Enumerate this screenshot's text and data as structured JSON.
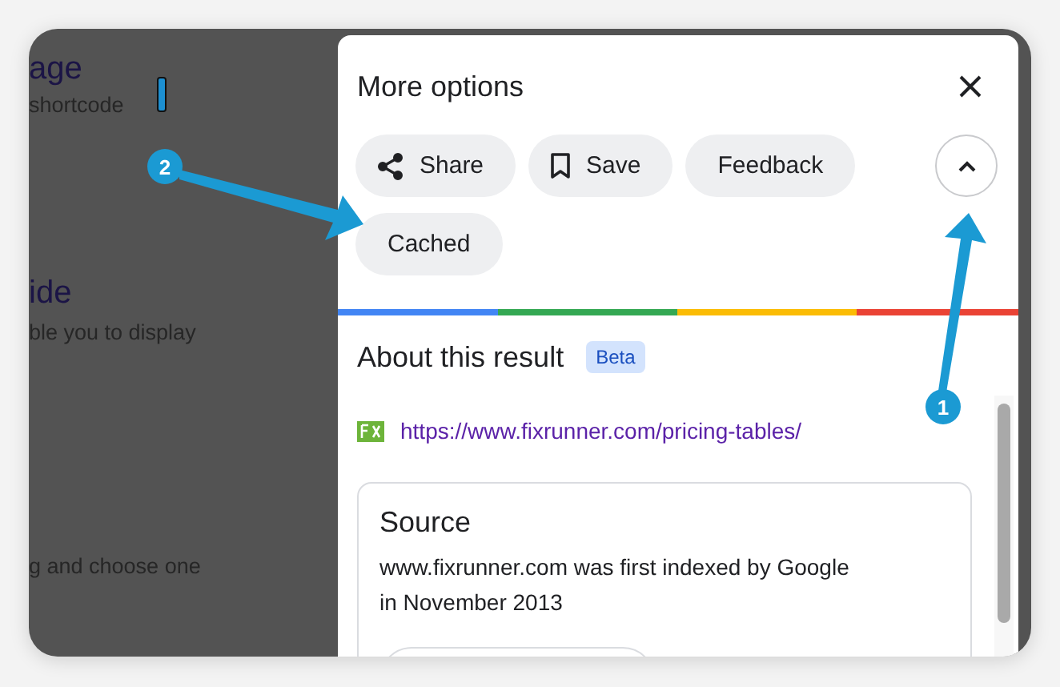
{
  "background_page": {
    "texts": [
      {
        "kind": "heading",
        "text": "age"
      },
      {
        "kind": "body",
        "text": "shortcode"
      },
      {
        "kind": "heading",
        "text": "ide"
      },
      {
        "kind": "body",
        "text": "ble you to display"
      },
      {
        "kind": "body",
        "text": "g and choose one"
      }
    ]
  },
  "panel": {
    "title": "More options",
    "expanded": true,
    "actions": [
      {
        "kind": "share",
        "label": "Share"
      },
      {
        "kind": "save",
        "label": "Save"
      },
      {
        "kind": "plain",
        "label": "Feedback"
      },
      {
        "kind": "plain",
        "label": "Cached"
      }
    ],
    "about": {
      "title": "About this result",
      "badge": "Beta",
      "url": "https://www.fixrunner.com/pricing-tables/",
      "source": {
        "title": "Source",
        "text": "www.fixrunner.com was first indexed by Google in November 2013"
      }
    }
  },
  "callouts": [
    {
      "label": "1"
    },
    {
      "label": "2"
    }
  ]
}
